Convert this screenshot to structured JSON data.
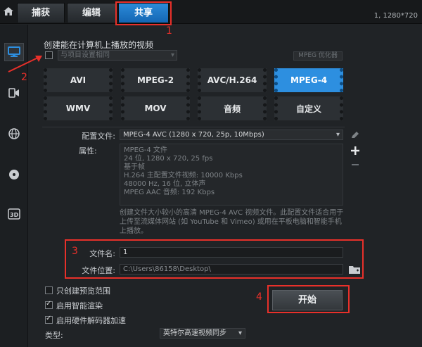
{
  "topbar": {
    "tabs": [
      {
        "label": "捕获"
      },
      {
        "label": "编辑"
      },
      {
        "label": "共享",
        "active": true
      }
    ],
    "resolution": "1, 1280*720"
  },
  "annotations": {
    "n1": "1",
    "n2": "2",
    "n3": "3",
    "n4": "4",
    "color": "#e8302a"
  },
  "rail": {
    "items": [
      "computer-icon",
      "device-icon",
      "web-icon",
      "disc-icon",
      "3d-icon"
    ],
    "active": "computer-icon"
  },
  "main": {
    "title": "创建能在计算机上播放的视频",
    "same_as_project": "与项目设置相同",
    "mpeg_optimizer": "MPEG 优化器",
    "formats": [
      {
        "label": "AVI"
      },
      {
        "label": "MPEG-2"
      },
      {
        "label": "AVC/H.264"
      },
      {
        "label": "MPEG-4",
        "selected": true
      },
      {
        "label": "WMV"
      },
      {
        "label": "MOV"
      },
      {
        "label": "音频"
      },
      {
        "label": "自定义"
      }
    ],
    "profile_label": "配置文件:",
    "profile_value": "MPEG-4 AVC (1280 x 720, 25p, 10Mbps)",
    "props_label": "属性:",
    "props_lines": [
      "MPEG-4 文件",
      "24 位, 1280 x 720, 25 fps",
      "基于帧",
      "H.264 主配置文件视频: 10000 Kbps",
      "48000 Hz, 16 位, 立体声",
      "MPEG AAC 音频: 192 Kbps"
    ],
    "description": "创建文件大小较小的高清 MPEG-4 AVC 视频文件。此配置文件适合用于上传至流媒体网站 (如 YouTube 和 Vimeo) 或用在平板电脑和智能手机上播放。",
    "filename_label": "文件名:",
    "filename_value": "1",
    "location_label": "文件位置:",
    "location_value": "C:\\Users\\86158\\Desktop\\",
    "opt_preview": "只创建预览范围",
    "opt_smart": "启用智能渲染",
    "opt_hw": "启用硬件解码器加速",
    "type_label": "类型:",
    "type_value": "英特尔高速视频同步",
    "start_label": "开始",
    "accent": "#2d8fe0"
  }
}
